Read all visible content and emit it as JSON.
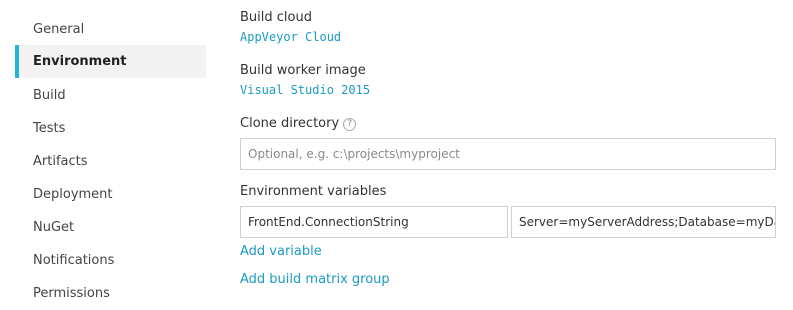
{
  "sidebar": {
    "items": [
      {
        "label": "General"
      },
      {
        "label": "Environment"
      },
      {
        "label": "Build"
      },
      {
        "label": "Tests"
      },
      {
        "label": "Artifacts"
      },
      {
        "label": "Deployment"
      },
      {
        "label": "NuGet"
      },
      {
        "label": "Notifications"
      },
      {
        "label": "Permissions"
      }
    ],
    "active": "Environment"
  },
  "build_cloud": {
    "label": "Build cloud",
    "value": "AppVeyor Cloud"
  },
  "build_worker_image": {
    "label": "Build worker image",
    "value": "Visual Studio 2015"
  },
  "clone_directory": {
    "label": "Clone directory",
    "help_icon": "?",
    "placeholder": "Optional, e.g. c:\\projects\\myproject",
    "value": ""
  },
  "environment_variables": {
    "label": "Environment variables",
    "rows": [
      {
        "name": "FrontEnd.ConnectionString",
        "value": "Server=myServerAddress;Database=myDataB"
      }
    ]
  },
  "links": {
    "add_variable": "Add variable",
    "add_build_matrix_group": "Add build matrix group"
  },
  "colors": {
    "accent": "#1fb6d8",
    "link": "#1a9bc4",
    "active_bg": "#f3f3f3"
  }
}
